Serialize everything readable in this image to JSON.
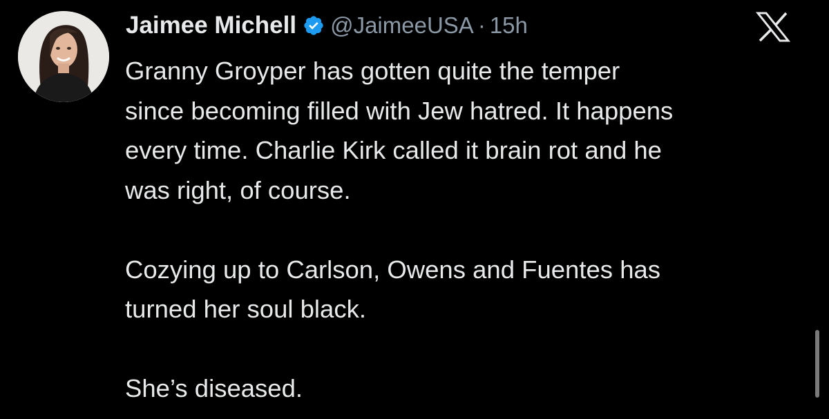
{
  "tweet": {
    "author": {
      "display_name": "Jaimee Michell",
      "verified_icon": "verified-badge-icon",
      "handle": "@JaimeeUSA",
      "separator": "·",
      "time": "15h",
      "avatar_icon": "avatar-photo"
    },
    "paragraphs": [
      {
        "lines": [
          "Granny Groyper has gotten quite the temper",
          "since becoming filled with Jew hatred. It happens",
          "every time. Charlie Kirk called it brain rot and he",
          "was right, of course."
        ]
      },
      {
        "lines": [
          "Cozying up to Carlson, Owens and Fuentes has",
          "turned her soul black."
        ]
      },
      {
        "lines": [
          "She’s diseased."
        ]
      }
    ]
  },
  "brand": {
    "logo_icon": "x-logo-icon"
  },
  "colors": {
    "background": "#000000",
    "text_primary": "#e7e9ea",
    "text_secondary": "#8b98a5",
    "verified_blue": "#1d9bf0",
    "scrollbar": "#7a7a7a"
  }
}
